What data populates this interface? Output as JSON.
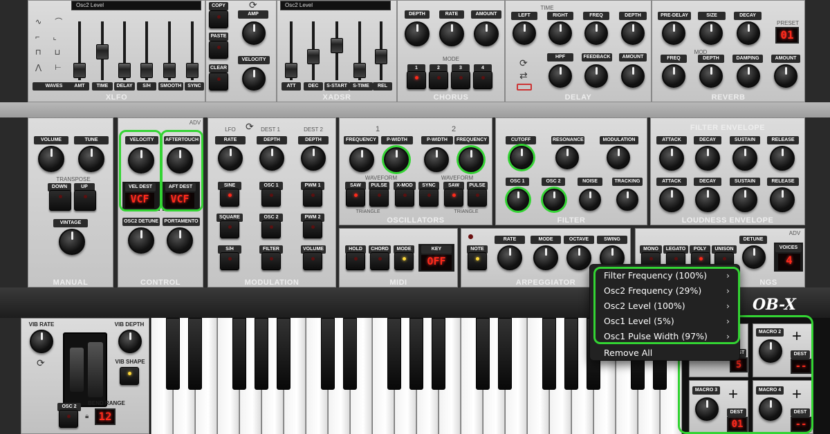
{
  "xlfo": {
    "display": "Osc2 Level",
    "section_title": "XLFO",
    "waves_label": "WAVES",
    "slider_labels": [
      "AMT",
      "TIME",
      "DELAY",
      "S/H",
      "SMOOTH",
      "SYNC"
    ],
    "buttons": [
      "COPY",
      "PASTE",
      "CLEAR"
    ],
    "knob_labels": [
      "AMP",
      "VELOCITY"
    ]
  },
  "xadsr": {
    "display": "Osc2 Level",
    "section_title": "XADSR",
    "slider_labels": [
      "ATT",
      "DEC",
      "S-START",
      "S-TIME",
      "REL"
    ]
  },
  "chorus": {
    "section_title": "CHORUS",
    "knob_labels": [
      "DEPTH",
      "RATE",
      "AMOUNT"
    ],
    "mode_label": "MODE",
    "mode_buttons": [
      "1",
      "2",
      "3",
      "4"
    ]
  },
  "delay": {
    "section_title": "DELAY",
    "time_label": "TIME",
    "knob_labels": [
      "LEFT",
      "RIGHT",
      "FREQ",
      "DEPTH"
    ],
    "knob_labels2": [
      "HPF",
      "FEEDBACK",
      "AMOUNT"
    ]
  },
  "reverb": {
    "section_title": "REVERB",
    "knob_labels": [
      "PRE-DELAY",
      "SIZE",
      "DECAY"
    ],
    "mod_label": "MOD",
    "knob_labels2": [
      "FREQ",
      "DEPTH",
      "DAMPING",
      "AMOUNT"
    ],
    "preset_label": "PRESET",
    "preset_value": "01"
  },
  "manual": {
    "section_title": "MANUAL",
    "knob_labels": [
      "VOLUME",
      "TUNE"
    ],
    "transpose_label": "TRANSPOSE",
    "transpose_buttons": [
      "DOWN",
      "UP"
    ],
    "vintage_label": "VINTAGE"
  },
  "control": {
    "section_title": "CONTROL",
    "adv": "ADV",
    "knob_labels": [
      "VELOCITY",
      "AFTERTOUCH"
    ],
    "dest_labels": [
      "VEL DEST",
      "AFT DEST"
    ],
    "dest_values": [
      "VCF",
      "VCF"
    ],
    "knob_labels2": [
      "OSC2 DETUNE",
      "PORTAMENTO"
    ]
  },
  "modulation": {
    "section_title": "MODULATION",
    "col_labels": [
      "LFO",
      "DEST 1",
      "DEST 2"
    ],
    "knob_labels": [
      "RATE",
      "DEPTH",
      "DEPTH"
    ],
    "lfo_buttons": [
      "SINE",
      "SQUARE",
      "S/H"
    ],
    "dest1_buttons": [
      "OSC 1",
      "OSC 2",
      "FILTER"
    ],
    "dest2_buttons": [
      "PWM 1",
      "PWM 2",
      "VOLUME"
    ]
  },
  "oscillators": {
    "section_title": "OSCILLATORS",
    "osc_numbers": [
      "1",
      "2"
    ],
    "knob_labels": [
      "FREQUENCY",
      "P-WIDTH",
      "P-WIDTH",
      "FREQUENCY"
    ],
    "waveform_label": "WAVEFORM",
    "buttons": [
      "SAW",
      "PULSE",
      "X-MOD",
      "SYNC",
      "SAW",
      "PULSE"
    ],
    "triangle_label": "TRIANGLE"
  },
  "filter": {
    "section_title": "FILTER",
    "knob_labels": [
      "CUTOFF",
      "RESONANCE",
      "MODULATION"
    ],
    "knob_labels2": [
      "OSC 1",
      "OSC 2",
      "NOISE",
      "TRACKING"
    ]
  },
  "filter_env": {
    "title": "FILTER ENVELOPE",
    "knob_labels": [
      "ATTACK",
      "DECAY",
      "SUSTAIN",
      "RELEASE"
    ]
  },
  "loudness_env": {
    "title": "LOUDNESS ENVELOPE",
    "knob_labels": [
      "ATTACK",
      "DECAY",
      "SUSTAIN",
      "RELEASE"
    ]
  },
  "midi": {
    "section_title": "MIDI",
    "buttons": [
      "HOLD",
      "CHORD",
      "MODE"
    ],
    "key_label": "KEY",
    "key_value": "OFF"
  },
  "arpeggiator": {
    "section_title": "ARPEGGIATOR",
    "note_label": "NOTE",
    "knob_labels": [
      "RATE",
      "MODE",
      "OCTAVE",
      "SWING"
    ]
  },
  "voices": {
    "section_title": "SETTINGS",
    "section_title_visible": "NGS",
    "adv": "ADV",
    "buttons": [
      "MONO",
      "LEGATO",
      "POLY",
      "UNISON"
    ],
    "detune_label": "DETUNE",
    "voices_label": "VOICES",
    "voices_value": "4"
  },
  "bottom": {
    "vib_rate": "VIB RATE",
    "vib_depth": "VIB DEPTH",
    "vib_shape": "VIB SHAPE",
    "osc2_button": "OSC 2",
    "bend_range": "BEND RANGE",
    "bend_value": "12",
    "logo": "OB-X"
  },
  "macros": [
    {
      "label": "MACRO 2",
      "dest_label": "DEST",
      "dest_value": "--"
    },
    {
      "label": "MACRO 3",
      "dest_label": "DEST",
      "dest_value": "01"
    },
    {
      "label": "MACRO 4",
      "dest_label": "DEST",
      "dest_value": "--"
    }
  ],
  "macro1_dest_value": "5",
  "context_menu": {
    "items": [
      {
        "label": "Filter Frequency (100%)"
      },
      {
        "label": "Osc2 Frequency (29%)"
      },
      {
        "label": "Osc2 Level (100%)"
      },
      {
        "label": "Osc1 Level (5%)"
      },
      {
        "label": "Osc1 Pulse Width (97%)"
      }
    ],
    "remove_all": "Remove All",
    "arrow": "›"
  },
  "colors": {
    "highlight": "#33d433",
    "led_red": "#ff2a1a",
    "panel": "#d0d0d0"
  }
}
